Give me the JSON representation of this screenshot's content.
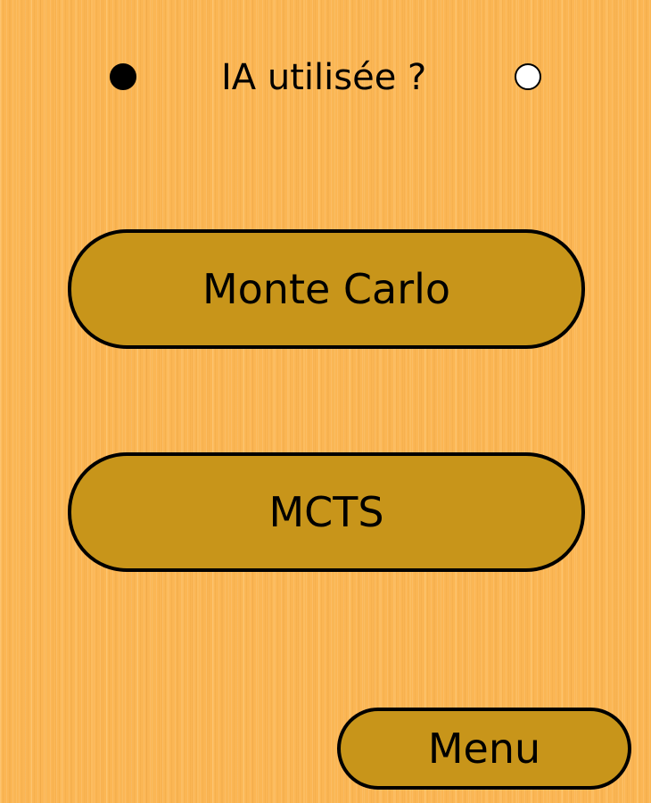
{
  "header": {
    "title": "IA utilisée ?",
    "tokens": [
      {
        "name": "black",
        "color": "#000000"
      },
      {
        "name": "white",
        "color": "#ffffff"
      }
    ]
  },
  "ai_options": [
    {
      "label": "Monte Carlo"
    },
    {
      "label": "MCTS"
    }
  ],
  "menu_button": {
    "label": "Menu"
  },
  "colors": {
    "background": "#fbb654",
    "button_fill": "#c8951a",
    "button_border": "#000000"
  }
}
